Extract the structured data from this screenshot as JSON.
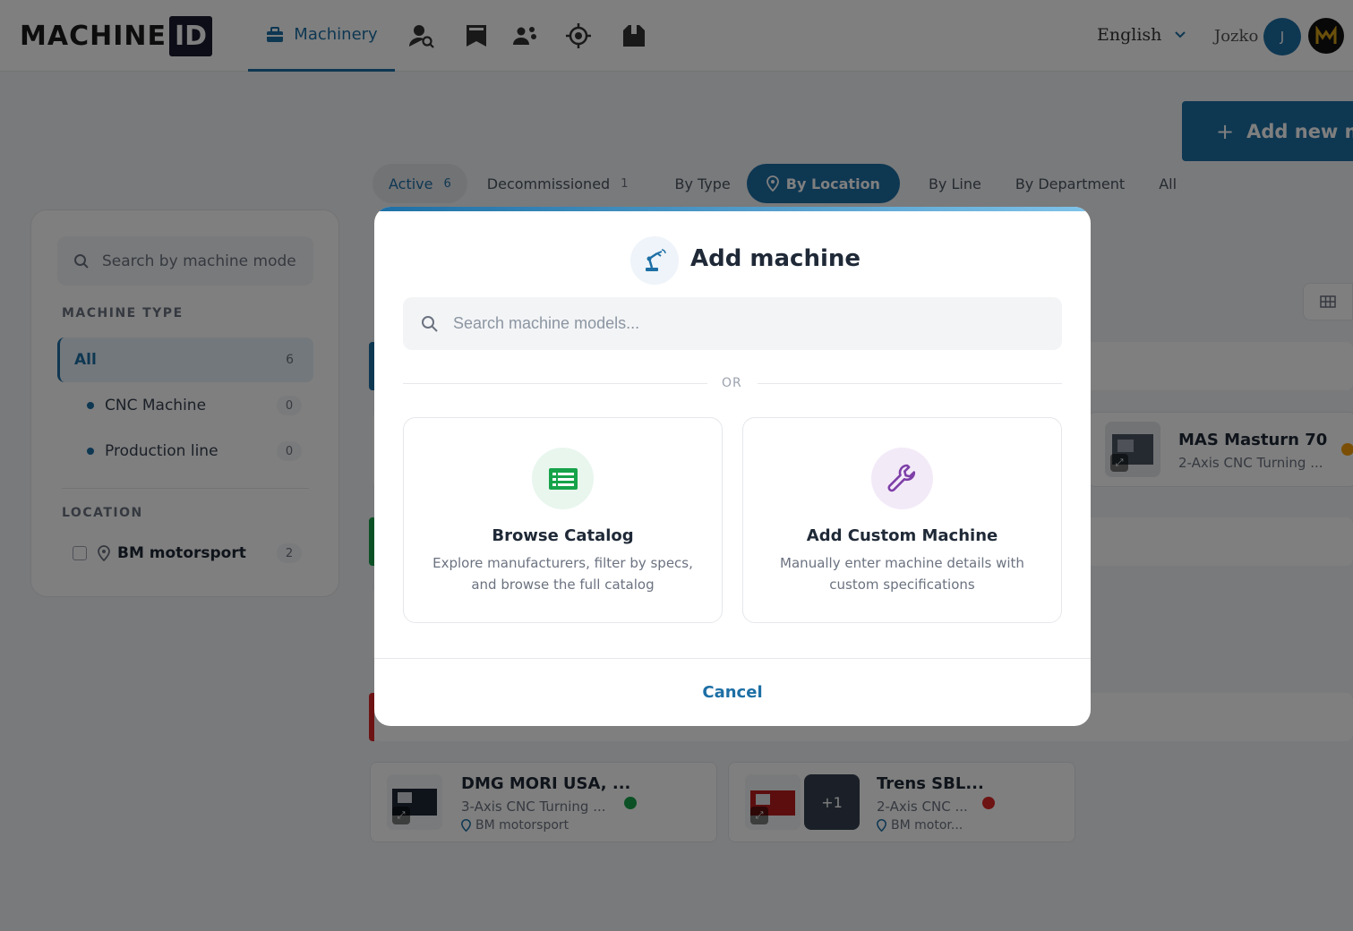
{
  "header": {
    "logo_text": "MACHINE",
    "logo_box": "ID",
    "nav_active_label": "Machinery",
    "nav_icons": [
      "person-search-icon",
      "bookmark-icon",
      "team-icon",
      "target-icon",
      "box-icon"
    ],
    "language": "English",
    "user_name": "Jozko",
    "avatar_initial": "J"
  },
  "toolbar": {
    "add_new_label": "Add new ma"
  },
  "tabs": [
    {
      "label": "Active",
      "count": "6"
    },
    {
      "label": "Decommissioned",
      "count": "1"
    },
    {
      "label": "By Type"
    },
    {
      "label": "By Location"
    },
    {
      "label": "By Line"
    },
    {
      "label": "By Department"
    },
    {
      "label": "All"
    }
  ],
  "sidebar": {
    "search_placeholder": "Search by machine mode",
    "machine_type_heading": "MACHINE TYPE",
    "all_label": "All",
    "all_count": "6",
    "types": [
      {
        "label": "CNC Machine",
        "count": "0"
      },
      {
        "label": "Production line",
        "count": "0"
      }
    ],
    "location_heading": "LOCATION",
    "locations": [
      {
        "label": "BM motorsport",
        "count": "2"
      }
    ]
  },
  "machines": [
    {
      "title": "MAS Masturn 70",
      "subtitle": "2-Axis CNC Turning ...",
      "status_color": "#f59e0b"
    },
    {
      "title": "DMG MORI USA, ...",
      "subtitle": "3-Axis CNC Turning ...",
      "location": "BM motorsport",
      "status_color": "#16a34a"
    },
    {
      "title": "Trens SBL...",
      "subtitle": "2-Axis CNC ...",
      "location": "BM motor...",
      "extra_images": "+1",
      "status_color": "#dc2626"
    }
  ],
  "modal": {
    "title": "Add machine",
    "search_placeholder": "Search machine models...",
    "or_text": "OR",
    "browse": {
      "title": "Browse Catalog",
      "description": "Explore manufacturers, filter by specs, and browse the full catalog"
    },
    "custom": {
      "title": "Add Custom Machine",
      "description": "Manually enter machine details with custom specifications"
    },
    "cancel_label": "Cancel"
  },
  "colors": {
    "accent": "#1d6fa5",
    "browse_icon": "#16a34a",
    "custom_icon": "#7e3fa8"
  }
}
